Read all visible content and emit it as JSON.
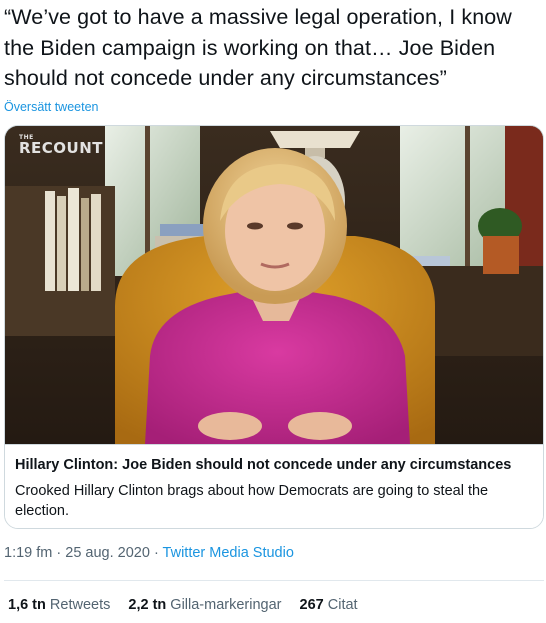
{
  "tweet": {
    "text": "“We’ve got to have a massive legal operation, I know the Biden campaign is working on that… Joe Biden should not concede under any circumstances”",
    "translate_label": "Översätt tweeten"
  },
  "card": {
    "brand_small": "THE",
    "brand_big": "RECOUNT",
    "title": "Hillary Clinton: Joe Biden should not concede under any circumstances",
    "description": "Crooked Hillary Clinton brags about how Democrats are going to steal the election."
  },
  "meta": {
    "time": "1:19 fm",
    "separator1": " · ",
    "date": "25 aug. 2020",
    "separator2": " · ",
    "source": "Twitter Media Studio"
  },
  "stats": {
    "retweets_count": "1,6 tn",
    "retweets_label": "Retweets",
    "likes_count": "2,2 tn",
    "likes_label": "Gilla-markeringar",
    "quotes_count": "267",
    "quotes_label": "Citat"
  },
  "colors": {
    "link": "#1b95e0",
    "muted": "#536471",
    "text": "#0f1419",
    "border": "#cfd9de"
  }
}
